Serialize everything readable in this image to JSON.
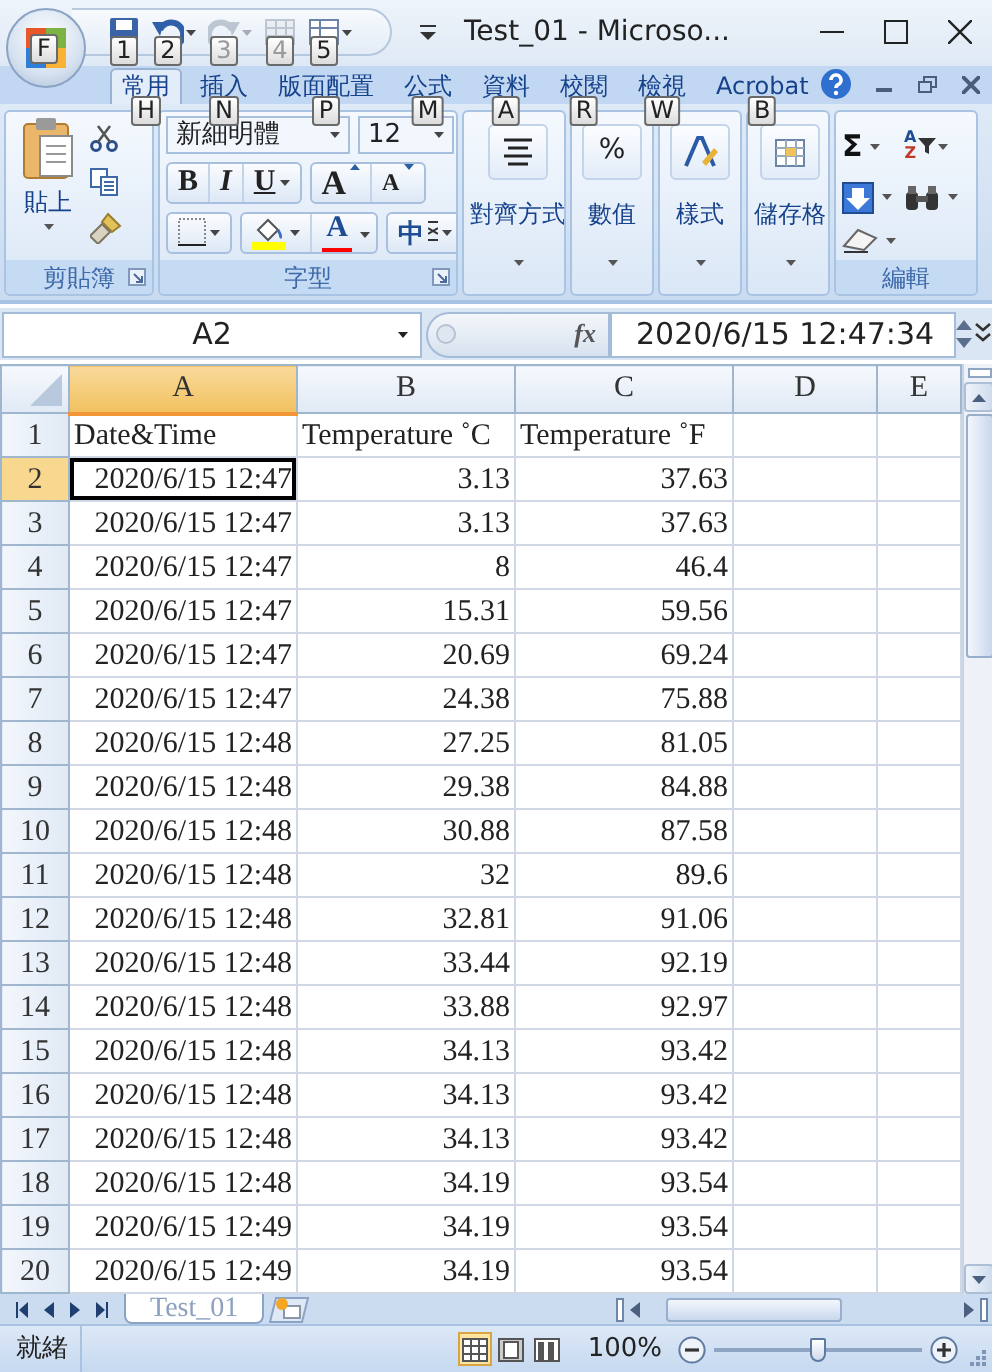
{
  "window": {
    "title": "Test_01 - Microso...",
    "office_keytip": "F"
  },
  "quick_access": [
    {
      "kind": "save",
      "keytip": "1",
      "disabled": false
    },
    {
      "kind": "undo",
      "keytip": "2",
      "disabled": false
    },
    {
      "kind": "redo",
      "keytip": "3",
      "disabled": true
    },
    {
      "kind": "table",
      "keytip": "4",
      "disabled": true
    },
    {
      "kind": "grid",
      "keytip": "5",
      "disabled": false
    }
  ],
  "tabs": [
    {
      "label": "常用",
      "keytip": "H",
      "selected": true
    },
    {
      "label": "插入",
      "keytip": "N",
      "selected": false
    },
    {
      "label": "版面配置",
      "keytip": "P",
      "selected": false
    },
    {
      "label": "公式",
      "keytip": "M",
      "selected": false
    },
    {
      "label": "資料",
      "keytip": "A",
      "selected": false
    },
    {
      "label": "校閱",
      "keytip": "R",
      "selected": false
    },
    {
      "label": "檢視",
      "keytip": "W",
      "selected": false
    },
    {
      "label": "Acrobat",
      "keytip": "B",
      "selected": false
    }
  ],
  "ribbon": {
    "groups": [
      {
        "kind": "clipboard",
        "label": "剪貼簿",
        "paste_label": "貼上"
      },
      {
        "kind": "font",
        "label": "字型",
        "font_name": "新細明體",
        "font_size": "12",
        "format_buttons": [
          {
            "kind": "bold",
            "glyph": "B"
          },
          {
            "kind": "italic",
            "glyph": "I"
          },
          {
            "kind": "underline",
            "glyph": "U"
          }
        ],
        "size_buttons": [
          {
            "kind": "grow",
            "glyph": "A"
          },
          {
            "kind": "shrink",
            "glyph": "A"
          }
        ],
        "fill": {
          "color": "#ffff00"
        },
        "font_color": {
          "glyph": "A",
          "color": "#ff0000"
        },
        "phonetic_glyph": "中"
      },
      {
        "kind": "alignment",
        "button_label": "對齊方式"
      },
      {
        "kind": "number",
        "button_label": "數值",
        "glyph": "%"
      },
      {
        "kind": "styles",
        "button_label": "樣式"
      },
      {
        "kind": "cells",
        "button_label": "儲存格"
      },
      {
        "kind": "editing",
        "label": "編輯",
        "sum_glyph": "Σ",
        "sort_glyphs": [
          "A",
          "Z"
        ]
      }
    ]
  },
  "formula_bar": {
    "name_box": "A2",
    "function_label": "fx",
    "formula": "2020/6/15  12:47:34"
  },
  "sheet": {
    "columns": [
      {
        "label": "A",
        "selected": true
      },
      {
        "label": "B",
        "selected": false
      },
      {
        "label": "C",
        "selected": false
      },
      {
        "label": "D",
        "selected": false
      },
      {
        "label": "E",
        "selected": false
      }
    ],
    "rows": [
      {
        "number": "1",
        "kind": "header",
        "selected": false,
        "cells": [
          "Date&Time",
          "Temperature ˚C",
          "Temperature ˚F"
        ]
      },
      {
        "number": "2",
        "kind": "data",
        "selected": true,
        "cells": [
          "2020/6/15 12:47",
          "3.13",
          "37.63"
        ]
      },
      {
        "number": "3",
        "kind": "data",
        "selected": false,
        "cells": [
          "2020/6/15 12:47",
          "3.13",
          "37.63"
        ]
      },
      {
        "number": "4",
        "kind": "data",
        "selected": false,
        "cells": [
          "2020/6/15 12:47",
          "8",
          "46.4"
        ]
      },
      {
        "number": "5",
        "kind": "data",
        "selected": false,
        "cells": [
          "2020/6/15 12:47",
          "15.31",
          "59.56"
        ]
      },
      {
        "number": "6",
        "kind": "data",
        "selected": false,
        "cells": [
          "2020/6/15 12:47",
          "20.69",
          "69.24"
        ]
      },
      {
        "number": "7",
        "kind": "data",
        "selected": false,
        "cells": [
          "2020/6/15 12:47",
          "24.38",
          "75.88"
        ]
      },
      {
        "number": "8",
        "kind": "data",
        "selected": false,
        "cells": [
          "2020/6/15 12:48",
          "27.25",
          "81.05"
        ]
      },
      {
        "number": "9",
        "kind": "data",
        "selected": false,
        "cells": [
          "2020/6/15 12:48",
          "29.38",
          "84.88"
        ]
      },
      {
        "number": "10",
        "kind": "data",
        "selected": false,
        "cells": [
          "2020/6/15 12:48",
          "30.88",
          "87.58"
        ]
      },
      {
        "number": "11",
        "kind": "data",
        "selected": false,
        "cells": [
          "2020/6/15 12:48",
          "32",
          "89.6"
        ]
      },
      {
        "number": "12",
        "kind": "data",
        "selected": false,
        "cells": [
          "2020/6/15 12:48",
          "32.81",
          "91.06"
        ]
      },
      {
        "number": "13",
        "kind": "data",
        "selected": false,
        "cells": [
          "2020/6/15 12:48",
          "33.44",
          "92.19"
        ]
      },
      {
        "number": "14",
        "kind": "data",
        "selected": false,
        "cells": [
          "2020/6/15 12:48",
          "33.88",
          "92.97"
        ]
      },
      {
        "number": "15",
        "kind": "data",
        "selected": false,
        "cells": [
          "2020/6/15 12:48",
          "34.13",
          "93.42"
        ]
      },
      {
        "number": "16",
        "kind": "data",
        "selected": false,
        "cells": [
          "2020/6/15 12:48",
          "34.13",
          "93.42"
        ]
      },
      {
        "number": "17",
        "kind": "data",
        "selected": false,
        "cells": [
          "2020/6/15 12:48",
          "34.13",
          "93.42"
        ]
      },
      {
        "number": "18",
        "kind": "data",
        "selected": false,
        "cells": [
          "2020/6/15 12:48",
          "34.19",
          "93.54"
        ]
      },
      {
        "number": "19",
        "kind": "data",
        "selected": false,
        "cells": [
          "2020/6/15 12:49",
          "34.19",
          "93.54"
        ]
      },
      {
        "number": "20",
        "kind": "data",
        "selected": false,
        "cells": [
          "2020/6/15 12:49",
          "34.19",
          "93.54"
        ]
      }
    ]
  },
  "sheet_tabs": [
    {
      "label": "Test_01",
      "selected": true
    }
  ],
  "status_bar": {
    "status": "就緒",
    "views": [
      {
        "kind": "normal",
        "selected": true
      },
      {
        "kind": "page_layout",
        "selected": false
      },
      {
        "kind": "page_break",
        "selected": false
      }
    ],
    "zoom": "100%",
    "zoom_slider": {
      "level": 0.5
    }
  }
}
